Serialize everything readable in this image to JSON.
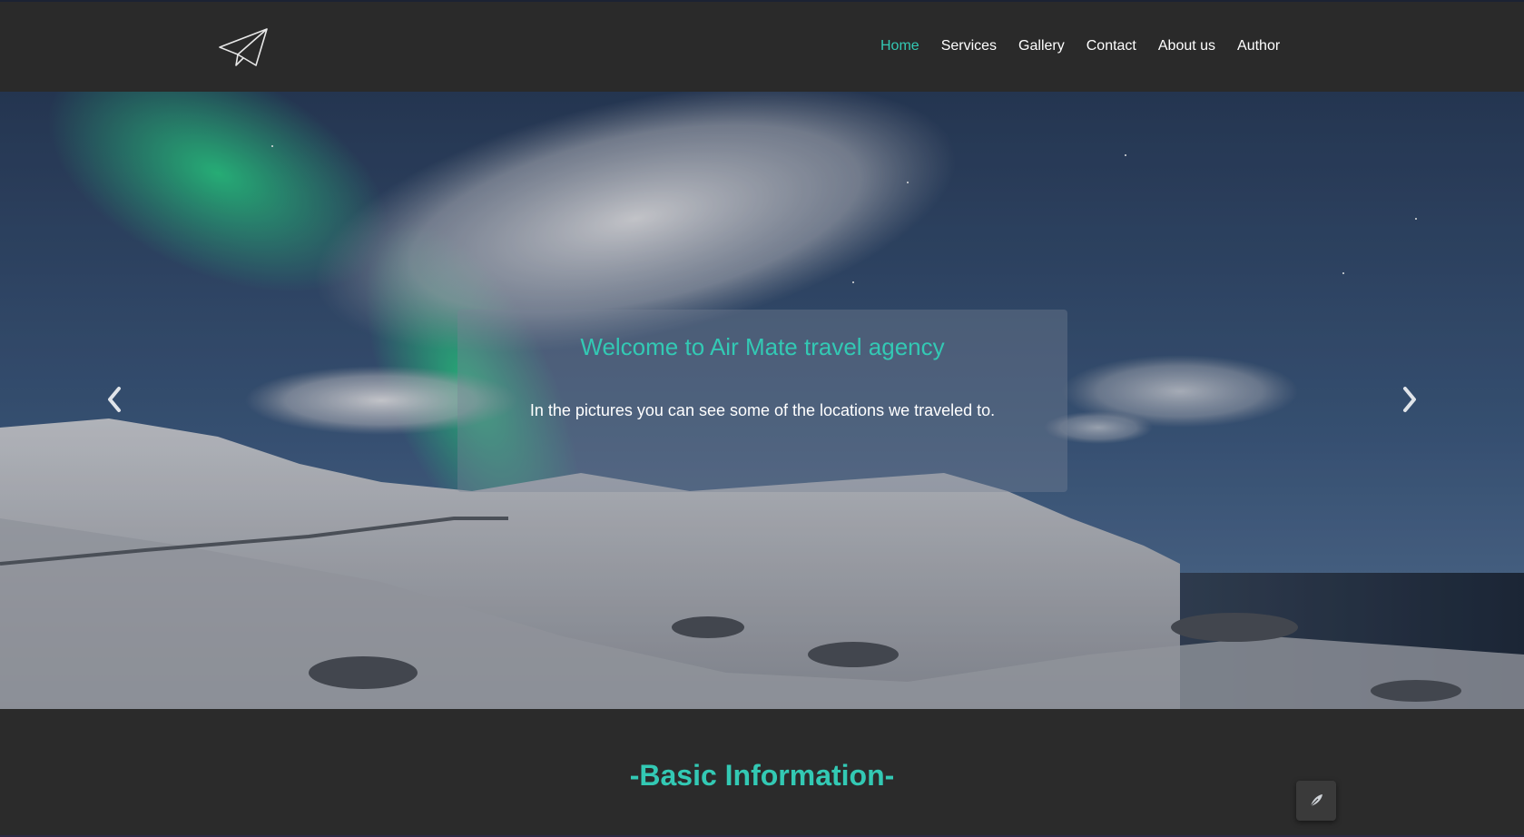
{
  "header": {
    "logo_icon": "paper-plane-icon",
    "nav": [
      {
        "label": "Home",
        "active": true
      },
      {
        "label": "Services",
        "active": false
      },
      {
        "label": "Gallery",
        "active": false
      },
      {
        "label": "Contact",
        "active": false
      },
      {
        "label": "About us",
        "active": false
      },
      {
        "label": "Author",
        "active": false
      }
    ]
  },
  "hero": {
    "title": "Welcome to Air Mate travel agency",
    "text": "In the pictures you can see some of the locations we traveled to.",
    "prev_icon": "chevron-left-icon",
    "next_icon": "chevron-right-icon"
  },
  "section": {
    "title": "-Basic Information-"
  },
  "floating_button": {
    "icon": "feather-icon"
  },
  "colors": {
    "accent": "#33c9b4",
    "header_bg": "#2a2a2a",
    "page_bg": "#2b2b2b"
  }
}
